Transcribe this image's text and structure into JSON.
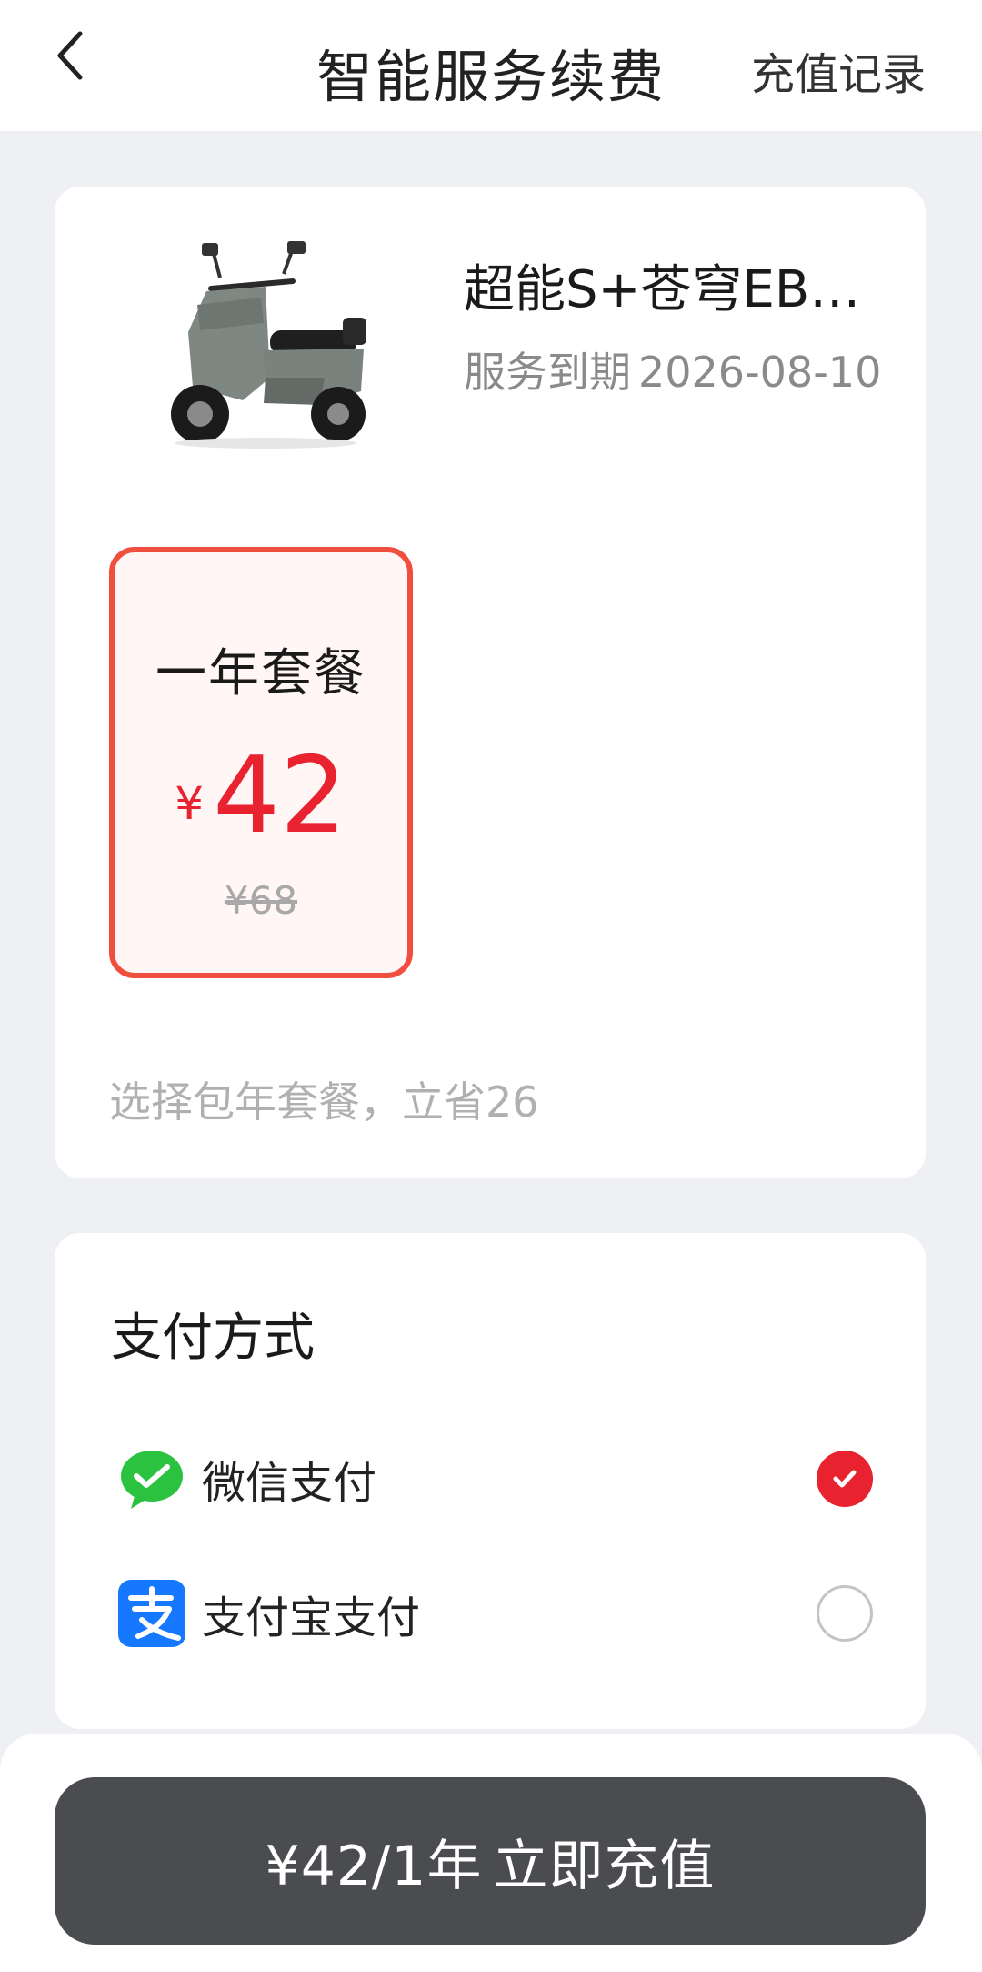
{
  "header": {
    "title": "智能服务续费",
    "right_link": "充值记录",
    "back_icon": "chevron-left-icon"
  },
  "vehicle": {
    "name": "超能S+苍穹EB…",
    "expire_label": "服务到期",
    "expire_date": "2026-08-10",
    "image_icon": "scooter-image"
  },
  "plan": {
    "name": "一年套餐",
    "currency": "¥",
    "price": "42",
    "original_price": "¥68",
    "selected": true
  },
  "save_tip": "选择包年套餐，立省26",
  "payment": {
    "title": "支付方式",
    "methods": [
      {
        "label": "微信支付",
        "icon": "wechat-pay-icon",
        "selected": true
      },
      {
        "label": "支付宝支付",
        "icon": "alipay-icon",
        "selected": false
      }
    ]
  },
  "submit": {
    "price_text": "¥42/1年",
    "action_text": "立即充值"
  },
  "colors": {
    "accent_red": "#e8222e",
    "plan_border": "#f04e3e",
    "button_bg": "#4b4c50",
    "page_bg": "#eef0f4"
  }
}
